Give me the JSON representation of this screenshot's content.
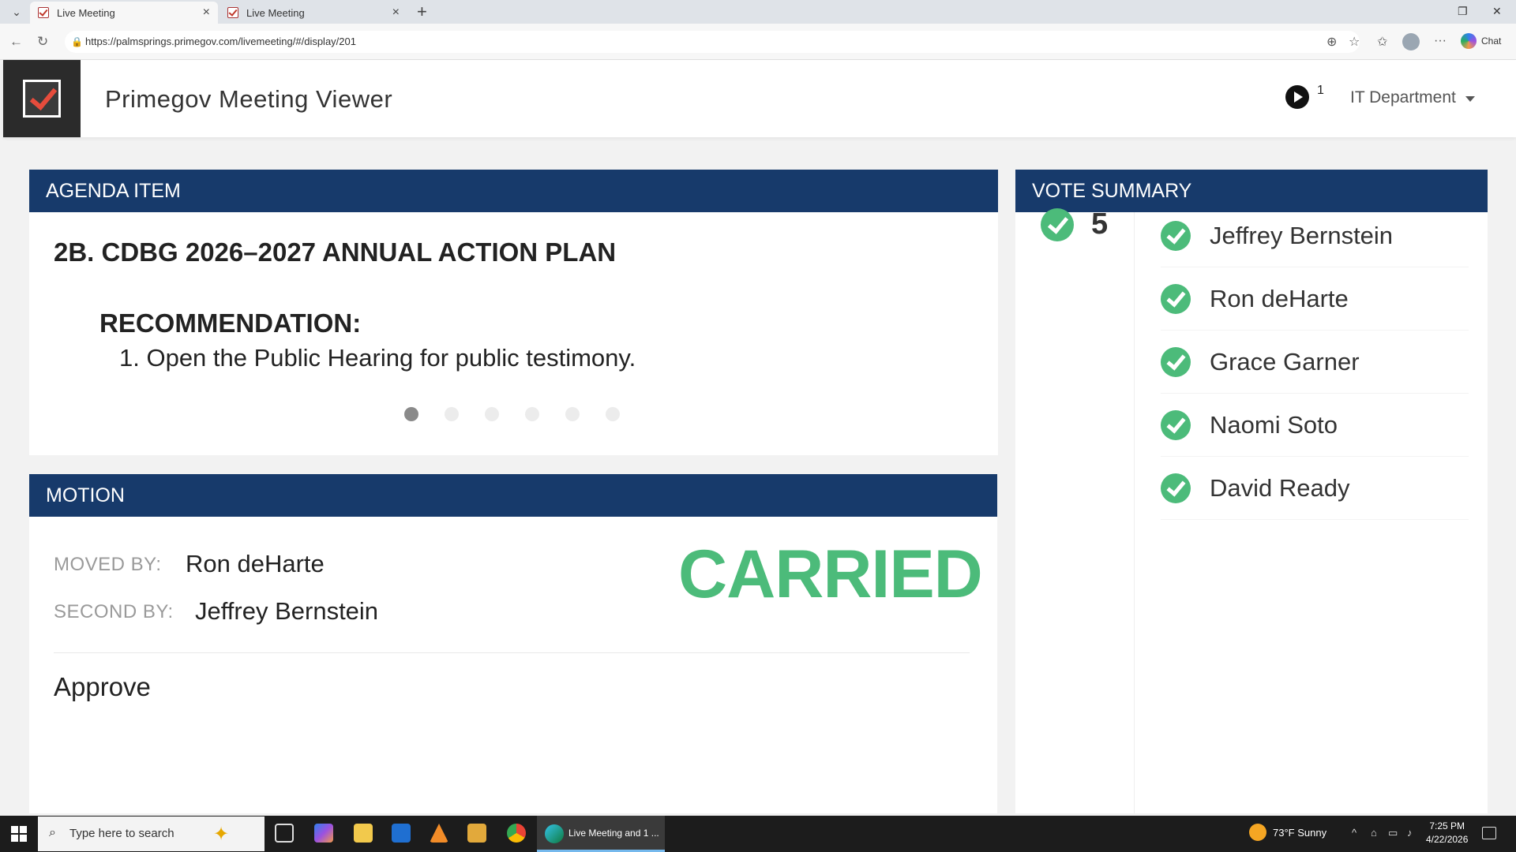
{
  "browser": {
    "tabs": [
      {
        "label": "Live Meeting",
        "active": true
      },
      {
        "label": "Live Meeting",
        "active": false
      }
    ],
    "url": "https://palmsprings.primegov.com/livemeeting/#/display/201",
    "chat_label": "Chat"
  },
  "header": {
    "app_title": "Primegov Meeting Viewer",
    "play_count": "1",
    "department": "IT Department"
  },
  "agenda": {
    "header": "AGENDA ITEM",
    "title": "2B. CDBG 2026–2027 ANNUAL ACTION PLAN",
    "recommendation_label": "RECOMMENDATION:",
    "recommendation_text": "1. Open the Public Hearing for public testimony.",
    "slide_count": 6,
    "active_slide": 1
  },
  "motion": {
    "header": "MOTION",
    "moved_by_label": "MOVED BY:",
    "moved_by": "Ron deHarte",
    "second_by_label": "SECOND BY:",
    "second_by": "Jeffrey Bernstein",
    "result": "CARRIED",
    "motion_text": "Approve"
  },
  "vote": {
    "header": "VOTE SUMMARY",
    "yes_count": "5",
    "voters": [
      {
        "name": "Jeffrey Bernstein"
      },
      {
        "name": "Ron deHarte"
      },
      {
        "name": "Grace Garner"
      },
      {
        "name": "Naomi Soto"
      },
      {
        "name": "David Ready"
      }
    ]
  },
  "taskbar": {
    "search_placeholder": "Type here to search",
    "active_app_label": "Live Meeting and 1 ...",
    "weather": "73°F Sunny",
    "time": "7:25 PM",
    "date": "4/22/2026"
  },
  "colors": {
    "header_navy": "#173a6b",
    "carried_green": "#4cbb7a",
    "logo_check_red": "#e74c3c"
  }
}
